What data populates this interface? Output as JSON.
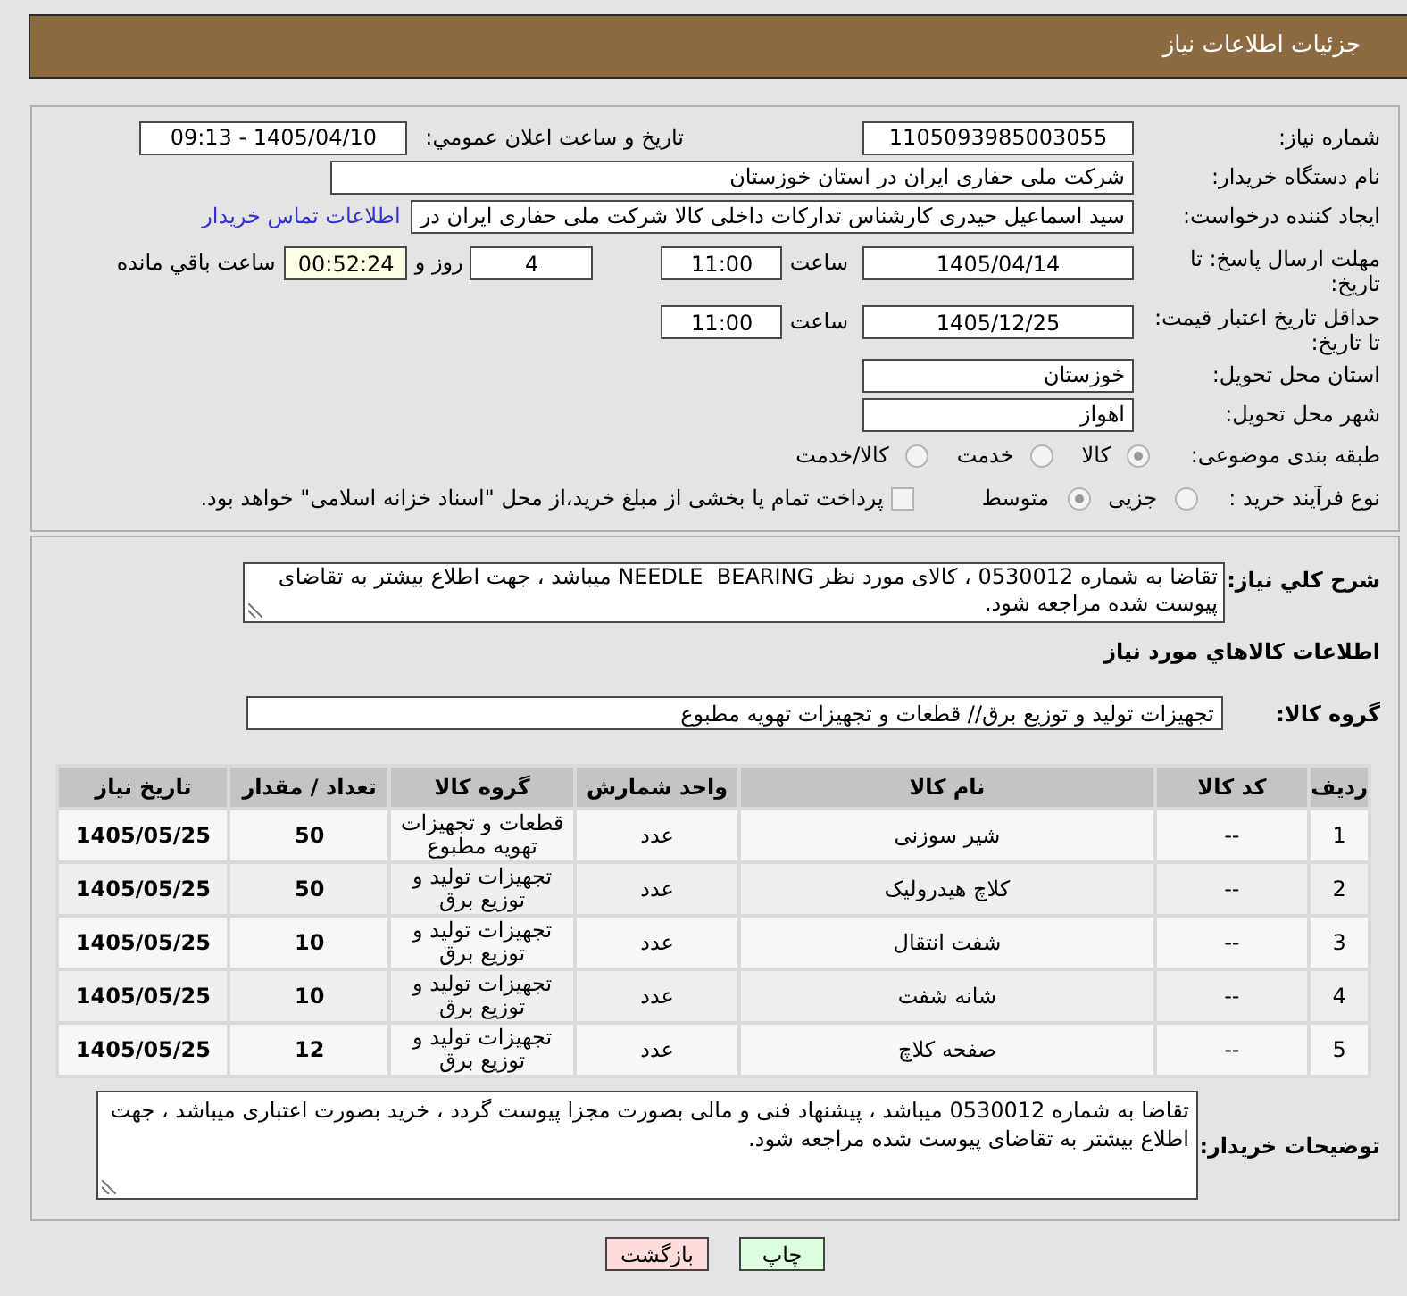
{
  "header": {
    "title": "جزئیات اطلاعات نیاز"
  },
  "details": {
    "need_number": {
      "label": "شماره نیاز:",
      "value": "1105093985003055"
    },
    "announce_datetime": {
      "label": "تاریخ و ساعت اعلان عمومي:",
      "value": "1405/04/10 - 09:13"
    },
    "buyer_org": {
      "label": "نام دستگاه خریدار:",
      "value": "شرکت ملی حفاری ایران در استان خوزستان"
    },
    "requester": {
      "label": "ایجاد کننده درخواست:",
      "value": "سید اسماعیل حیدری کارشناس تدارکات داخلی کالا شرکت ملی حفاری ایران در",
      "contact_link": "اطلاعات تماس خریدار"
    },
    "reply_deadline": {
      "label": "مهلت ارسال پاسخ: تا تاریخ:",
      "date": "1405/04/14",
      "time_label": "ساعت",
      "time": "11:00",
      "days": "4",
      "days_label": "روز و",
      "remaining": "00:52:24",
      "remaining_label": "ساعت باقي مانده"
    },
    "price_validity": {
      "label": "حداقل تاریخ اعتبار قیمت: تا تاریخ:",
      "date": "1405/12/25",
      "time_label": "ساعت",
      "time": "11:00"
    },
    "delivery_province": {
      "label": "استان محل تحویل:",
      "value": "خوزستان"
    },
    "delivery_city": {
      "label": "شهر محل تحویل:",
      "value": "اهواز"
    },
    "subject_category": {
      "label": "طبقه بندی موضوعی:",
      "options": [
        {
          "label": "کالا",
          "selected": true
        },
        {
          "label": "خدمت",
          "selected": false
        },
        {
          "label": "کالا/خدمت",
          "selected": false
        }
      ]
    },
    "purchase_process": {
      "label": "نوع فرآیند خرید :",
      "options": [
        {
          "label": "جزیی",
          "selected": false
        },
        {
          "label": "متوسط",
          "selected": true
        }
      ],
      "treasury_payment": {
        "label": "پرداخت تمام یا بخشی از مبلغ خرید،از محل \"اسناد خزانه اسلامی\" خواهد بود.",
        "checked": false
      }
    }
  },
  "needs": {
    "description_label": "شرح کلي نیاز:",
    "description": "تقاضا به شماره 0530012 ، کالای مورد نظر NEEDLE  BEARING میباشد ، جهت اطلاع بیشتر به تقاضای پیوست شده مراجعه شود.",
    "goods_heading": "اطلاعات کالاهاي مورد نیاز",
    "goods_group_label": "گروه کالا:",
    "goods_group": "تجهیزات تولید و توزیع برق// قطعات و تجهیزات تهویه مطبوع",
    "table": {
      "columns": [
        "ردیف",
        "کد کالا",
        "نام کالا",
        "واحد شمارش",
        "گروه کالا",
        "تعداد / مقدار",
        "تاریخ نیاز"
      ],
      "rows": [
        {
          "cells": [
            "1",
            "--",
            "شیر سوزنی",
            "عدد",
            "قطعات و تجهیزات تهویه مطبوع",
            "50",
            "1405/05/25"
          ]
        },
        {
          "cells": [
            "2",
            "--",
            "کلاچ هیدرولیک",
            "عدد",
            "تجهیزات تولید و توزیع برق",
            "50",
            "1405/05/25"
          ]
        },
        {
          "cells": [
            "3",
            "--",
            "شفت انتقال",
            "عدد",
            "تجهیزات تولید و توزیع برق",
            "10",
            "1405/05/25"
          ]
        },
        {
          "cells": [
            "4",
            "--",
            "شانه شفت",
            "عدد",
            "تجهیزات تولید و توزیع برق",
            "10",
            "1405/05/25"
          ]
        },
        {
          "cells": [
            "5",
            "--",
            "صفحه کلاچ",
            "عدد",
            "تجهیزات تولید و توزیع برق",
            "12",
            "1405/05/25"
          ]
        }
      ]
    },
    "buyer_notes_label": "توضیحات خریدار:",
    "buyer_notes": "تقاضا به شماره 0530012 میباشد ، پیشنهاد فنی و مالی بصورت مجزا پیوست گردد ، خرید بصورت اعتباری میباشد ، جهت اطلاع بیشتر به تقاضای پیوست شده مراجعه شود."
  },
  "buttons": [
    {
      "label": "چاپ",
      "kind": "print"
    },
    {
      "label": "بازگشت",
      "kind": "back"
    }
  ]
}
